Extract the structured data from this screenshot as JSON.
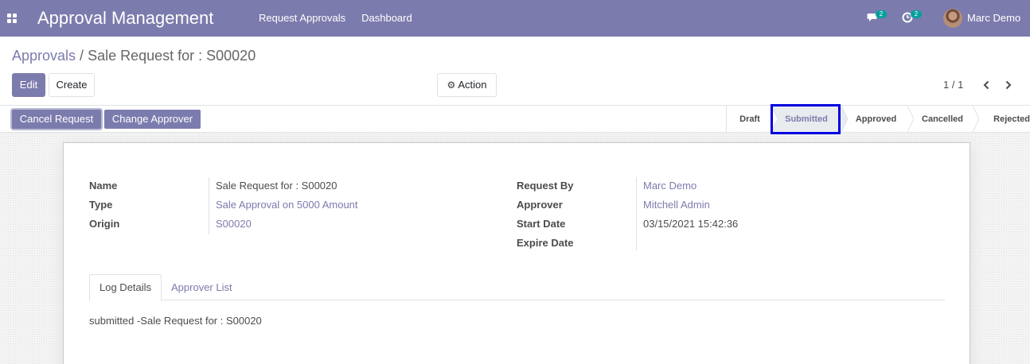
{
  "navbar": {
    "app_title": "Approval Management",
    "menu": [
      "Request Approvals",
      "Dashboard"
    ],
    "messages_count": "2",
    "activities_count": "2",
    "user_name": "Marc Demo"
  },
  "breadcrumb": {
    "parent": "Approvals",
    "separator": "/",
    "current": "Sale Request for : S00020"
  },
  "toolbar": {
    "edit_label": "Edit",
    "create_label": "Create",
    "action_label": "Action",
    "pager_value": "1 / 1"
  },
  "statusbar": {
    "buttons": [
      "Cancel Request",
      "Change Approver"
    ],
    "stages": [
      "Draft",
      "Submitted",
      "Approved",
      "Cancelled",
      "Rejected"
    ],
    "current_stage": "Submitted"
  },
  "form": {
    "left": [
      {
        "label": "Name",
        "value": "Sale Request for : S00020",
        "link": false
      },
      {
        "label": "Type",
        "value": "Sale Approval on 5000 Amount",
        "link": true
      },
      {
        "label": "Origin",
        "value": "S00020",
        "link": true
      }
    ],
    "right": [
      {
        "label": "Request By",
        "value": "Marc Demo",
        "link": true
      },
      {
        "label": "Approver",
        "value": "Mitchell Admin",
        "link": true
      },
      {
        "label": "Start Date",
        "value": "03/15/2021 15:42:36",
        "link": false
      },
      {
        "label": "Expire Date",
        "value": "",
        "link": false
      }
    ]
  },
  "tabs": [
    "Log Details",
    "Approver List"
  ],
  "log_details_text": "submitted -Sale Request for : S00020",
  "colors": {
    "brand": "#7c7bad",
    "badge": "#00a09d",
    "highlight": "#0000e0"
  }
}
